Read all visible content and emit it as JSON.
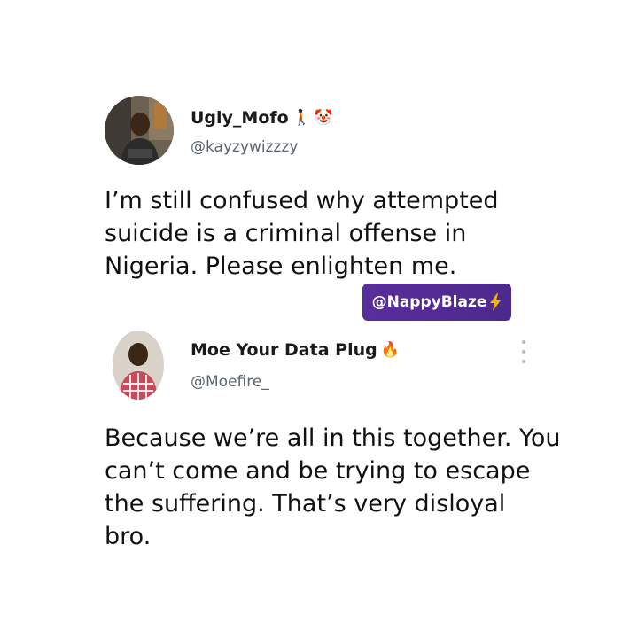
{
  "tweet1": {
    "display_name": "Ugly_Mofo",
    "name_emoji_1": "🚶🏿",
    "name_emoji_2": "🤡",
    "handle": "@kayzywizzzy",
    "text_lines": [
      "I’m still confused why attempted",
      "suicide is a criminal offense in",
      "Nigeria. Please enlighten me."
    ]
  },
  "watermark": {
    "text": "@NappyBlaze",
    "icon": "lightning-icon"
  },
  "tweet2": {
    "display_name": "Moe Your Data Plug",
    "name_emoji": "🔥",
    "handle": "@Moefire_",
    "more_icon": "more-vertical-icon",
    "text_lines": [
      "Because we’re all in this together. You",
      "can’t come and be trying to escape",
      "the suffering. That’s very disloyal",
      "bro."
    ]
  },
  "colors": {
    "background": "#ffffff",
    "text": "#111111",
    "handle": "#5b6671",
    "watermark_bg": "#5a2d9c",
    "lightning": "#f6b400"
  }
}
